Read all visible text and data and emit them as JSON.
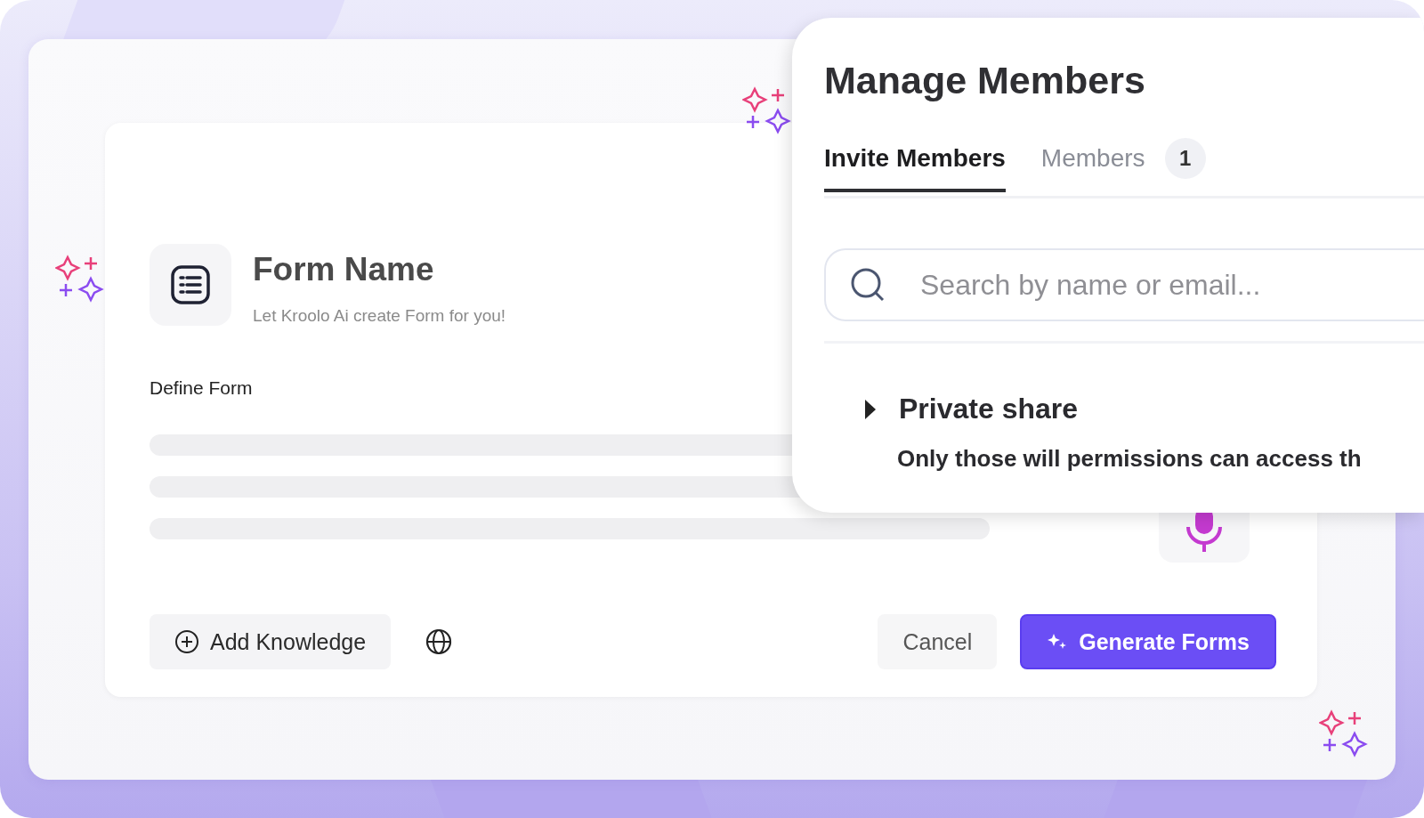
{
  "form_card": {
    "title": "Form Name",
    "subtitle": "Let Kroolo Ai create Form for you!",
    "field_label": "Define Form",
    "actions": [
      {
        "kind": "secondary",
        "label": "Add Knowledge"
      },
      {
        "kind": "icon"
      },
      {
        "kind": "plain",
        "label": "Cancel"
      },
      {
        "kind": "primary",
        "label": "Generate Forms"
      }
    ]
  },
  "manage_members": {
    "title": "Manage Members",
    "tabs": [
      {
        "label": "Invite Members",
        "selected": true
      },
      {
        "label": "Members",
        "selected": false,
        "count": "1"
      }
    ],
    "search": {
      "placeholder": "Search by name or email..."
    },
    "section": {
      "title": "Private share",
      "expanded": false,
      "description": "Only those will permissions can access th"
    }
  }
}
